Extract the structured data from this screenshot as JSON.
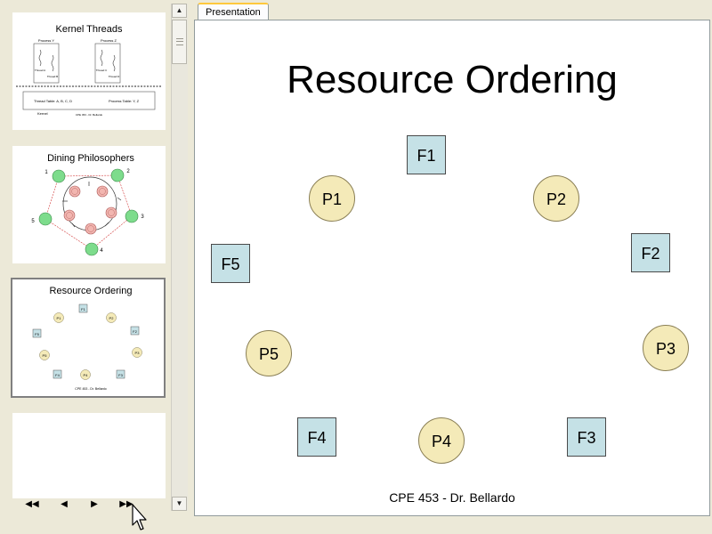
{
  "thumbnails": {
    "kernel": {
      "title": "Kernel Threads",
      "process_y": "Process Y",
      "process_z": "Process Z",
      "thread_a": "Thread A",
      "thread_b": "Thread B",
      "thread_c": "Thread C",
      "thread_d": "Thread D",
      "table_left": "Thread Table: A, B, C, D",
      "table_right": "Process Table: Y, Z",
      "kernel_label": "Kernel",
      "footer": "CPE 453 - Dr. Bellardo"
    },
    "dining": {
      "title": "Dining Philosophers",
      "n1": "1",
      "n2": "2",
      "n3": "3",
      "n4": "4",
      "n5": "5"
    },
    "resource": {
      "title": "Resource Ordering",
      "footer": "CPE 453 - Dr. Bellardo",
      "f1": "F1",
      "f2": "F2",
      "f3": "F3",
      "f4": "F4",
      "f5": "F5",
      "p1": "P1",
      "p2": "P2",
      "p3": "P3",
      "p4": "P4",
      "p5": "P5"
    }
  },
  "tabs": {
    "presentation": "Presentation"
  },
  "slide": {
    "title": "Resource Ordering",
    "footer": "CPE 453 - Dr. Bellardo",
    "forks": [
      "F1",
      "F2",
      "F3",
      "F4",
      "F5"
    ],
    "philosophers": [
      "P1",
      "P2",
      "P3",
      "P4",
      "P5"
    ]
  },
  "icons": {
    "nav_first": "double-left-arrow",
    "nav_prev": "left-arrow",
    "nav_next": "right-arrow",
    "nav_last": "double-right-arrow",
    "scroll_up": "up-arrow",
    "scroll_down": "down-arrow",
    "cursor": "mouse-pointer"
  },
  "colors": {
    "fork_fill": "#c5e1e6",
    "philosopher_fill": "#f4eab8",
    "tab_accent": "#ffc83c",
    "smiley_fill": "#7ddc8c",
    "plate_fill": "#f2b6b0"
  }
}
